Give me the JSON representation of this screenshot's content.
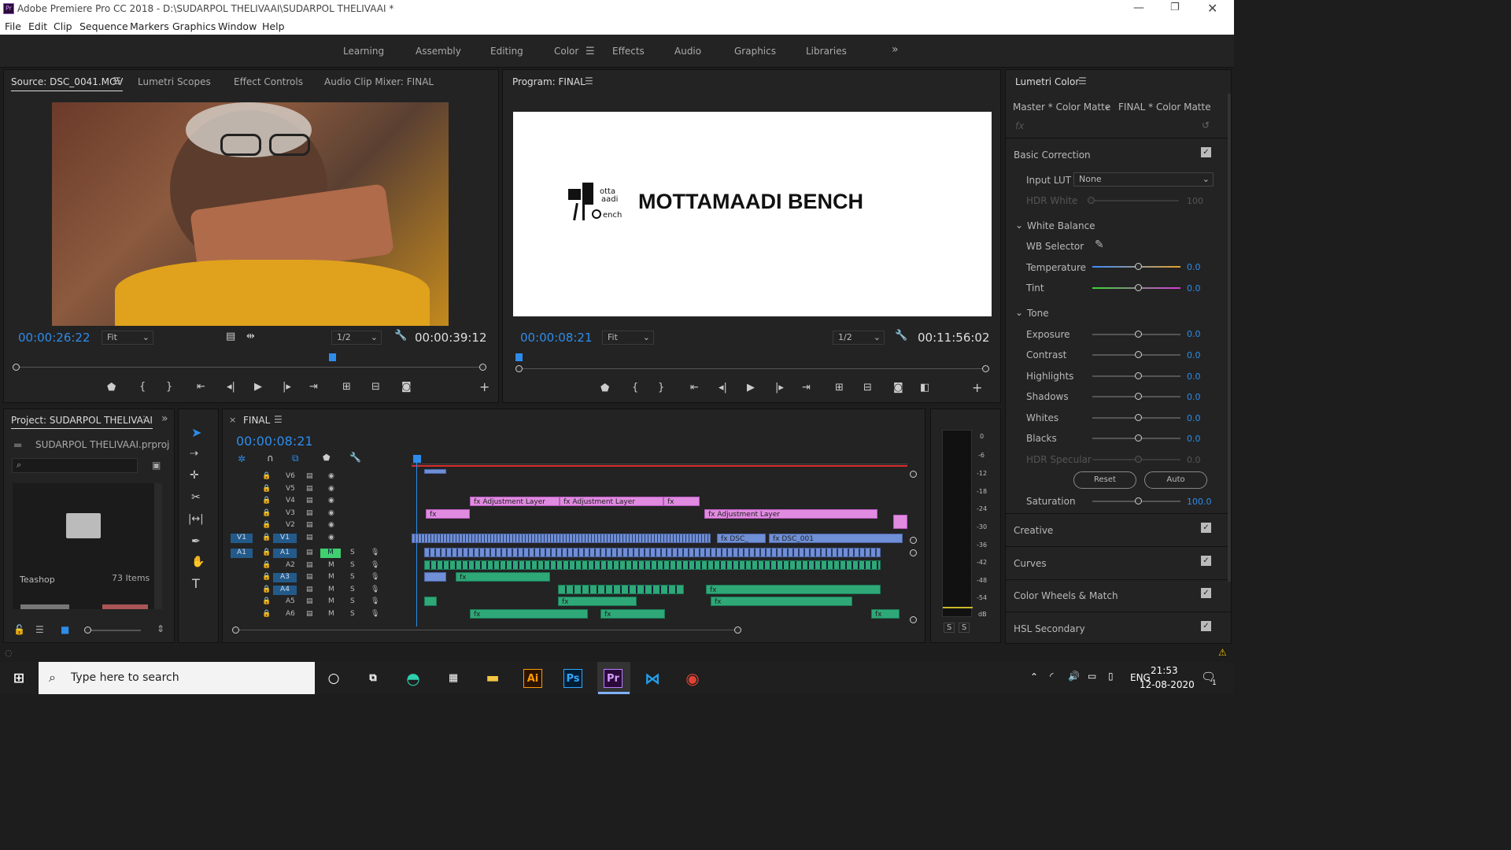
{
  "window": {
    "title": "Adobe Premiere Pro CC 2018 - D:\\SUDARPOL THELIVAAI\\SUDARPOL THELIVAAI *"
  },
  "menu": [
    "File",
    "Edit",
    "Clip",
    "Sequence",
    "Markers",
    "Graphics",
    "Window",
    "Help"
  ],
  "workspaces": [
    "Learning",
    "Assembly",
    "Editing",
    "Color",
    "Effects",
    "Audio",
    "Graphics",
    "Libraries"
  ],
  "active_workspace": "Color",
  "source_panel": {
    "tabs": [
      "Source: DSC_0041.MOV",
      "Lumetri Scopes",
      "Effect Controls",
      "Audio Clip Mixer: FINAL"
    ],
    "timecode_left": "00:00:26:22",
    "fit": "Fit",
    "resolution": "1/2",
    "timecode_right": "00:00:39:12"
  },
  "program_panel": {
    "tab": "Program: FINAL",
    "title_text": "MOTTAMAADI BENCH",
    "logo_text": [
      "otta",
      "aadi",
      "ench"
    ],
    "timecode_left": "00:00:08:21",
    "fit": "Fit",
    "resolution": "1/2",
    "timecode_right": "00:11:56:02"
  },
  "lumetri": {
    "tab": "Lumetri Color",
    "master": "Master * Color Matte",
    "final": "FINAL * Color Matte",
    "fx": "fx",
    "basic_correction": "Basic Correction",
    "input_lut_label": "Input LUT",
    "input_lut_value": "None",
    "hdr_white": "HDR White",
    "hdr_white_val": "100",
    "white_balance": "White Balance",
    "wb_selector": "WB Selector",
    "temperature": "Temperature",
    "temperature_val": "0.0",
    "tint": "Tint",
    "tint_val": "0.0",
    "tone": "Tone",
    "tone_rows": [
      {
        "label": "Exposure",
        "val": "0.0"
      },
      {
        "label": "Contrast",
        "val": "0.0"
      },
      {
        "label": "Highlights",
        "val": "0.0"
      },
      {
        "label": "Shadows",
        "val": "0.0"
      },
      {
        "label": "Whites",
        "val": "0.0"
      },
      {
        "label": "Blacks",
        "val": "0.0"
      },
      {
        "label": "HDR Specular",
        "val": "0.0"
      }
    ],
    "reset": "Reset",
    "auto": "Auto",
    "saturation": "Saturation",
    "saturation_val": "100.0",
    "sections": [
      "Creative",
      "Curves",
      "Color Wheels & Match",
      "HSL Secondary"
    ]
  },
  "project": {
    "tab": "Project: SUDARPOL THELIVAAI",
    "file": "SUDARPOL THELIVAAI.prproj",
    "bin_name": "Teashop",
    "items": "73 Items"
  },
  "timeline": {
    "tab": "FINAL",
    "timecode": "00:00:08:21",
    "video_tracks": [
      "V6",
      "V5",
      "V4",
      "V3",
      "V2",
      "V1"
    ],
    "audio_tracks": [
      "A1",
      "A2",
      "A3",
      "A4",
      "A5",
      "A6"
    ],
    "src_v": "V1",
    "src_a": "A1",
    "m": "M",
    "s": "S",
    "clips": {
      "adj1": "Adjustment Layer",
      "adj2": "Adjustment Layer",
      "adj3": "Adjustment Layer",
      "dsc1": "DSC_",
      "dsc2": "DSC_001",
      "fx": "fx"
    }
  },
  "meter": {
    "scale": [
      "0",
      "-6",
      "-12",
      "-18",
      "-24",
      "-30",
      "-36",
      "-42",
      "-48",
      "-54",
      "dB"
    ],
    "s": "S"
  },
  "taskbar": {
    "search": "Type here to search",
    "lang": "ENG",
    "time": "21:53",
    "date": "12-08-2020",
    "ai": "Ai",
    "ps": "Ps",
    "pr": "Pr",
    "notif": "1"
  }
}
